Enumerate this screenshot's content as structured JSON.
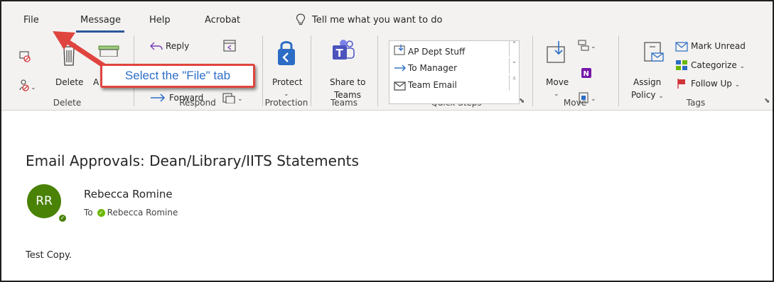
{
  "tabs": [
    {
      "label": "File"
    },
    {
      "label": "Message"
    },
    {
      "label": "Help"
    },
    {
      "label": "Acrobat"
    }
  ],
  "tell_me": {
    "text": "Tell me what you want to do",
    "icon": "lightbulb-icon"
  },
  "ribbon": {
    "delete_group": {
      "label": "Delete",
      "delete_label": "Delete",
      "archive_label": "A"
    },
    "respond_group": {
      "label": "Respond",
      "reply_label": "Reply",
      "forward_label": "Forward"
    },
    "protection_group": {
      "label": "Protection",
      "protect_label": "Protect"
    },
    "teams_group": {
      "label": "Teams",
      "share_label_1": "Share to",
      "share_label_2": "Teams"
    },
    "quick_steps_group": {
      "label": "Quick Steps",
      "items": [
        "AP Dept Stuff",
        "To Manager",
        "Team Email"
      ]
    },
    "move_group": {
      "label": "Move",
      "move_label": "Move"
    },
    "tags_group": {
      "label": "Tags",
      "assign_label_1": "Assign",
      "assign_label_2": "Policy",
      "mark_unread": "Mark Unread",
      "categorize": "Categorize",
      "follow_up": "Follow Up"
    }
  },
  "callout": {
    "text": "Select the \"File\" tab",
    "border_color": "#e0443e",
    "text_color": "#2c6fc7"
  },
  "message": {
    "subject": "Email Approvals: Dean/Library/IITS Statements",
    "avatar_initials": "RR",
    "avatar_color": "#498205",
    "sender": "Rebecca Romine",
    "to_label": "To",
    "to_name": "Rebecca Romine",
    "body": "Test Copy."
  },
  "colors": {
    "accent": "#2b579a",
    "ribbon_bg": "#f3f2f1"
  }
}
